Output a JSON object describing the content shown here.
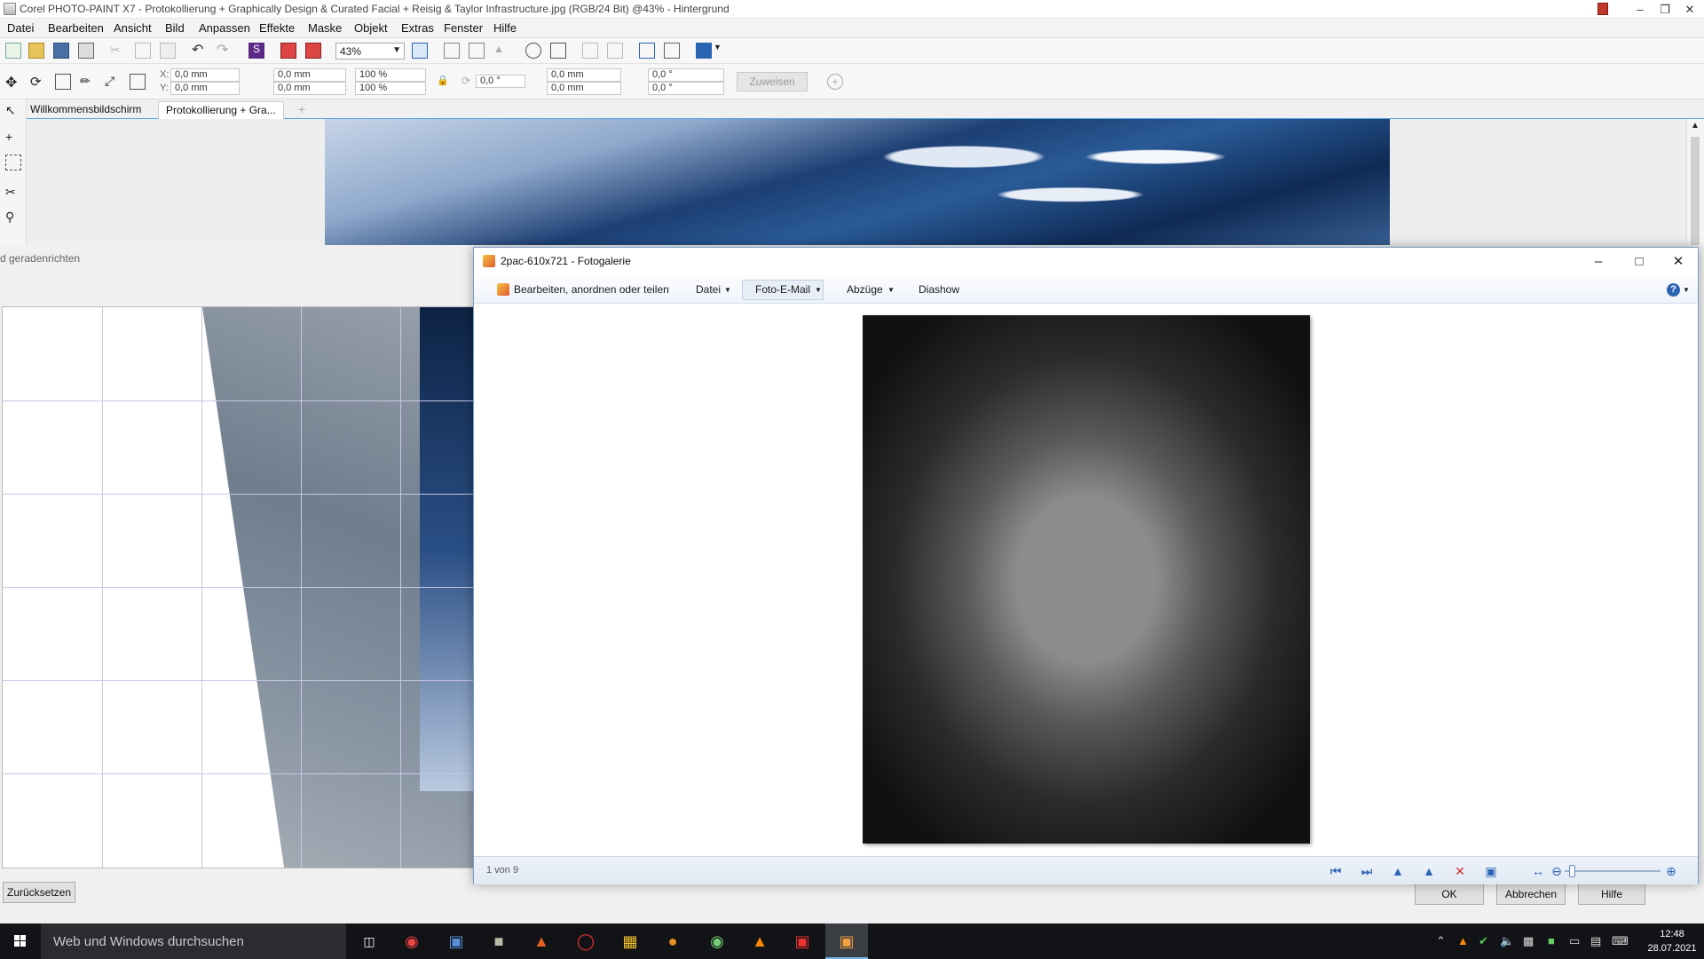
{
  "corel": {
    "title": "Corel PHOTO-PAINT X7 - Protokollierung + Graphically Design & Curated Facial + Reisig & Taylor Infrastructure.jpg (RGB/24 Bit) @43% - Hintergrund",
    "menu": [
      "Datei",
      "Bearbeiten",
      "Ansicht",
      "Bild",
      "Anpassen",
      "Effekte",
      "Maske",
      "Objekt",
      "Extras",
      "Fenster",
      "Hilfe"
    ],
    "zoom": "43%",
    "x_value": "0,0 mm",
    "y_value": "0,0 mm",
    "w_value": "0,0 mm",
    "h_value": "0,0 mm",
    "scale_w": "100 %",
    "scale_h": "100 %",
    "angle": "0,0 °",
    "skew1": "0,0 mm",
    "skew2": "0,0 mm",
    "off1": "0,0 °",
    "off2": "0,0 °",
    "assign_button": "Zuweisen",
    "x_label": "X:",
    "y_label": "Y:",
    "tabs": [
      "Willkommensbildschirm",
      "Protokollierung + Gra..."
    ]
  },
  "straighten_dialog": {
    "title_fragment": "d geradenrichten",
    "reset_button": "Zurücksetzen",
    "ok_button": "OK",
    "cancel_button": "Abbrechen",
    "help_button": "Hilfe"
  },
  "gallery": {
    "title": "2pac-610x721 - Fotogalerie",
    "menu_edit": "Bearbeiten, anordnen oder teilen",
    "menu_file": "Datei",
    "menu_email": "Foto-E-Mail",
    "menu_prints": "Abzüge",
    "menu_slideshow": "Diashow",
    "counter": "1 von 9",
    "zoom_level": 0.05
  },
  "taskbar": {
    "search_placeholder": "Web und Windows durchsuchen",
    "time": "12:48",
    "date": "28.07.2021"
  }
}
